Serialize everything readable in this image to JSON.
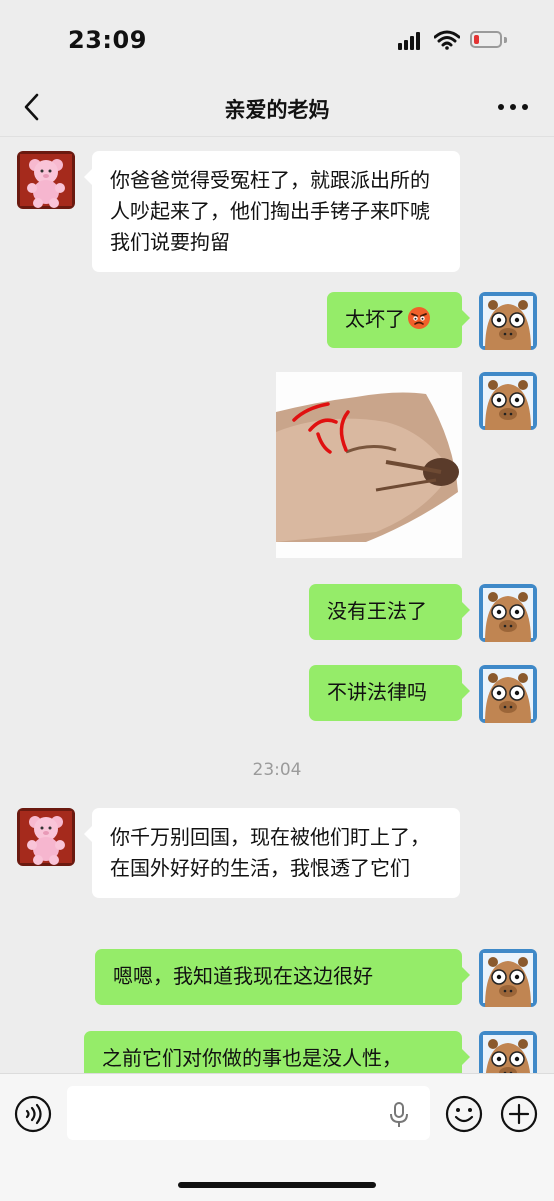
{
  "status_bar": {
    "time": "23:09",
    "battery_level": 0.2,
    "battery_color": "#e33333"
  },
  "header": {
    "title": "亲爱的老妈"
  },
  "colors": {
    "outgoing_bubble": "#95ec69",
    "incoming_bubble": "#ffffff",
    "background": "#ededed"
  },
  "messages": [
    {
      "from": "mom",
      "text": "你爸爸觉得受冤枉了，就跟派出所的人吵起来了，他们掏出手铐子来吓唬我们说要拘留"
    },
    {
      "from": "me",
      "text": "太坏了",
      "emoji": "angry-face"
    },
    {
      "from": "me",
      "type": "sticker",
      "sticker": "angry-dog-sticker"
    },
    {
      "from": "me",
      "text": "没有王法了"
    },
    {
      "from": "me",
      "text": "不讲法律吗"
    },
    {
      "type": "timestamp",
      "text": "23:04"
    },
    {
      "from": "mom",
      "text": "你千万别回国，现在被他们盯上了，在国外好好的生活，我恨透了它们"
    },
    {
      "from": "me",
      "text": "嗯嗯，我知道我现在这边很好"
    },
    {
      "from": "me",
      "text": "之前它们对你做的事也是没人性，"
    }
  ],
  "input_bar": {
    "placeholder": ""
  }
}
